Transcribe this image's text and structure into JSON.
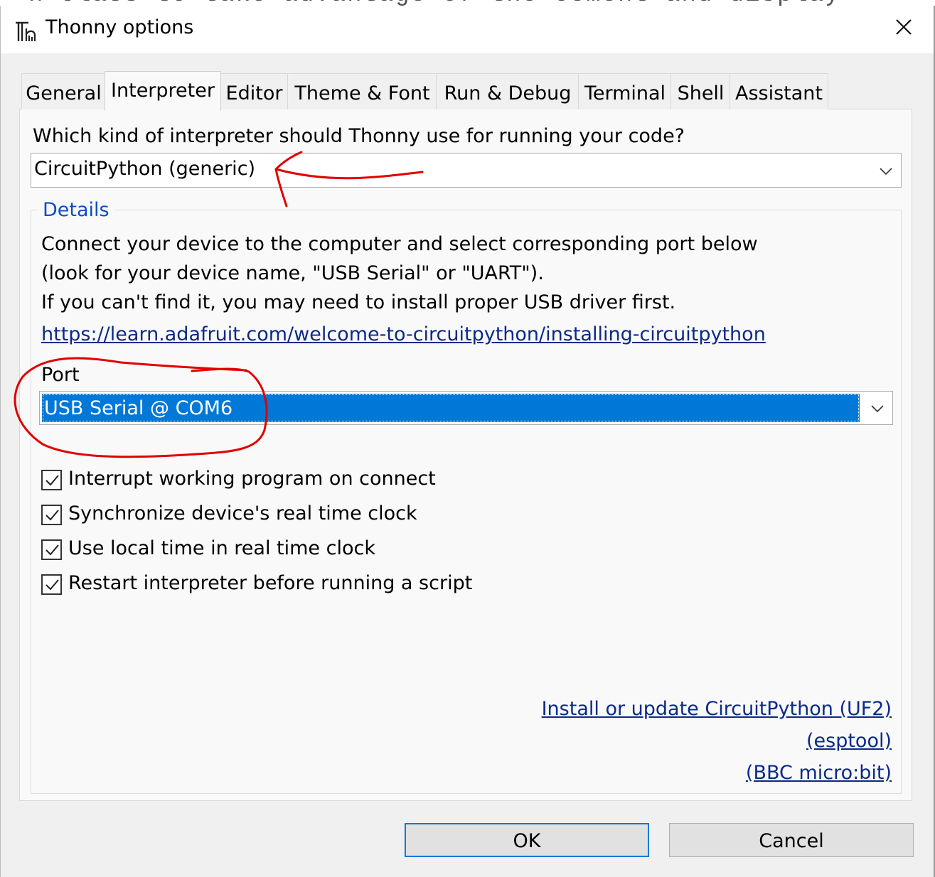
{
  "window": {
    "title": "Thonny options",
    "icon": "thonny-icon",
    "background_text": "n    class   to   take   advantage   of   the   cement   and   display"
  },
  "tabs": [
    {
      "label": "General",
      "active": false
    },
    {
      "label": "Interpreter",
      "active": true
    },
    {
      "label": "Editor",
      "active": false
    },
    {
      "label": "Theme & Font",
      "active": false
    },
    {
      "label": "Run & Debug",
      "active": false
    },
    {
      "label": "Terminal",
      "active": false
    },
    {
      "label": "Shell",
      "active": false
    },
    {
      "label": "Assistant",
      "active": false
    }
  ],
  "interpreter": {
    "question": "Which kind of interpreter should Thonny use for running your code?",
    "selected": "CircuitPython (generic)"
  },
  "details": {
    "legend": "Details",
    "lines": [
      "Connect your device to the computer and select corresponding port below",
      "(look for your device name, \"USB Serial\" or \"UART\").",
      "If you can't find it, you may need to install proper USB driver first."
    ],
    "link": "https://learn.adafruit.com/welcome-to-circuitpython/installing-circuitpython",
    "port_label": "Port",
    "port_value": "USB Serial @ COM6",
    "checkboxes": [
      {
        "label": "Interrupt working program on connect",
        "checked": true
      },
      {
        "label": "Synchronize device's real time clock",
        "checked": true
      },
      {
        "label": "Use local time in real time clock",
        "checked": true
      },
      {
        "label": "Restart interpreter before running a script",
        "checked": true
      }
    ],
    "install_links": [
      "Install or update CircuitPython (UF2)",
      "(esptool)",
      "(BBC micro:bit)"
    ]
  },
  "buttons": {
    "ok": "OK",
    "cancel": "Cancel"
  },
  "colors": {
    "selection": "#0078d7",
    "link": "#0a2a88",
    "legend": "#0c4ec3",
    "annotation": "#e00000"
  }
}
